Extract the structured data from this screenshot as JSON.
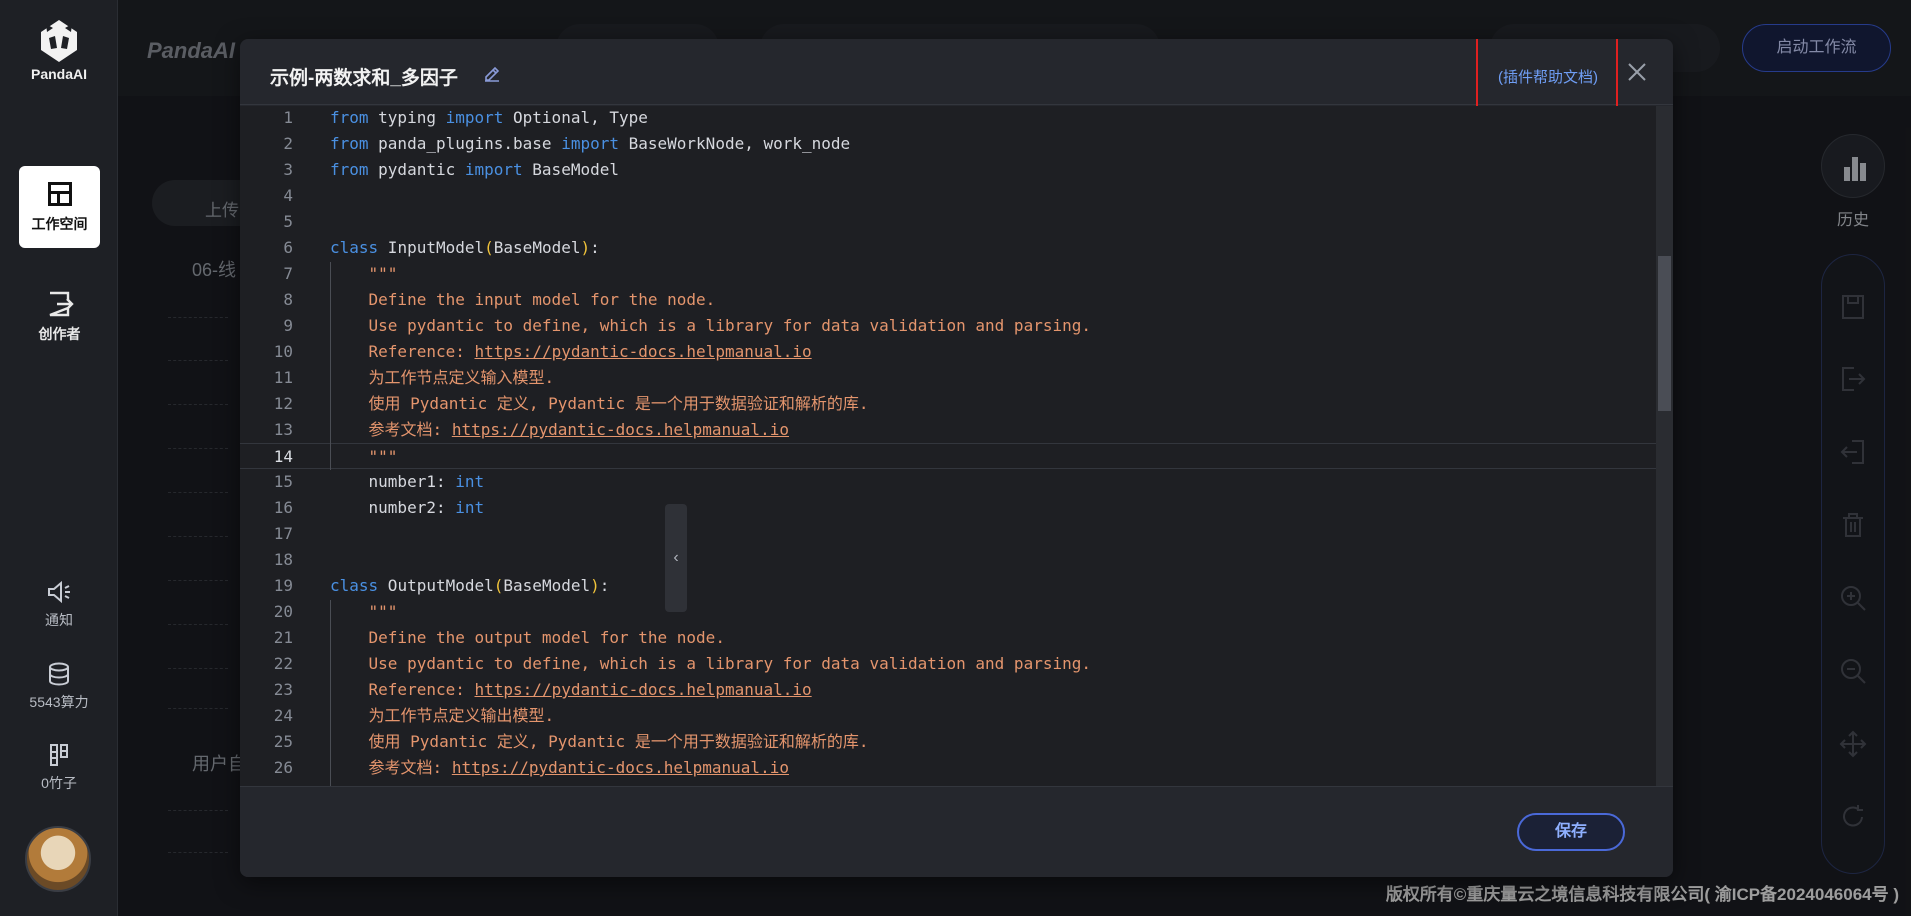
{
  "app": {
    "logo_text": "PandaAI",
    "brand_background": "PandaAI"
  },
  "sidebar": {
    "items": [
      {
        "label": "工作空间",
        "icon": "layout-icon"
      },
      {
        "label": "创作者",
        "icon": "exit-box-icon"
      }
    ],
    "notify": {
      "label": "通知",
      "icon": "speaker-icon"
    },
    "compute": {
      "label": "5543算力",
      "icon": "database-icon"
    },
    "bamboo": {
      "label": "0竹子",
      "icon": "bamboo-icon"
    }
  },
  "topbar": {
    "start_button": "启动工作流"
  },
  "background": {
    "upload_label": "上传",
    "folder1": "06-线",
    "folder2": "用户自"
  },
  "right_rail": {
    "history_label": "历史"
  },
  "modal": {
    "title": "示例-两数求和_多因子",
    "help_link": "(插件帮助文档)",
    "save_button": "保存",
    "collapse_glyph": "‹",
    "lines": [
      {
        "n": "1",
        "parts": [
          {
            "t": "from",
            "c": "kw"
          },
          {
            "t": " typing ",
            "c": "cls"
          },
          {
            "t": "import",
            "c": "kw"
          },
          {
            "t": " Optional, Type",
            "c": "cls"
          }
        ]
      },
      {
        "n": "2",
        "parts": [
          {
            "t": "from",
            "c": "kw"
          },
          {
            "t": " panda_plugins.base ",
            "c": "cls"
          },
          {
            "t": "import",
            "c": "kw"
          },
          {
            "t": " BaseWorkNode, work_node",
            "c": "cls"
          }
        ]
      },
      {
        "n": "3",
        "parts": [
          {
            "t": "from",
            "c": "kw"
          },
          {
            "t": " pydantic ",
            "c": "cls"
          },
          {
            "t": "import",
            "c": "kw"
          },
          {
            "t": " BaseModel",
            "c": "cls"
          }
        ]
      },
      {
        "n": "4",
        "parts": []
      },
      {
        "n": "5",
        "parts": []
      },
      {
        "n": "6",
        "parts": [
          {
            "t": "class",
            "c": "kw"
          },
          {
            "t": " InputModel",
            "c": "cls"
          },
          {
            "t": "(",
            "c": "paren"
          },
          {
            "t": "BaseModel",
            "c": "cls"
          },
          {
            "t": ")",
            "c": "paren"
          },
          {
            "t": ":",
            "c": "cls"
          }
        ]
      },
      {
        "n": "7",
        "parts": [
          {
            "t": "    \"\"\"",
            "c": "doc"
          }
        ]
      },
      {
        "n": "8",
        "parts": [
          {
            "t": "    Define the input model for the node.",
            "c": "doc"
          }
        ]
      },
      {
        "n": "9",
        "parts": [
          {
            "t": "    Use pydantic to define, which is a library for data validation and parsing.",
            "c": "doc"
          }
        ]
      },
      {
        "n": "10",
        "parts": [
          {
            "t": "    Reference: ",
            "c": "doc"
          },
          {
            "t": "https://pydantic-docs.helpmanual.io",
            "c": "link"
          }
        ]
      },
      {
        "n": "11",
        "parts": [
          {
            "t": "    为工作节点定义输入模型.",
            "c": "doc"
          }
        ]
      },
      {
        "n": "12",
        "parts": [
          {
            "t": "    使用 Pydantic 定义, Pydantic 是一个用于数据验证和解析的库.",
            "c": "doc"
          }
        ]
      },
      {
        "n": "13",
        "parts": [
          {
            "t": "    参考文档: ",
            "c": "doc"
          },
          {
            "t": "https://pydantic-docs.helpmanual.io",
            "c": "link"
          }
        ]
      },
      {
        "n": "14",
        "parts": [
          {
            "t": "    \"\"\"",
            "c": "doc"
          }
        ],
        "current": true
      },
      {
        "n": "15",
        "parts": [
          {
            "t": "    number1: ",
            "c": "cls"
          },
          {
            "t": "int",
            "c": "kw"
          }
        ]
      },
      {
        "n": "16",
        "parts": [
          {
            "t": "    number2: ",
            "c": "cls"
          },
          {
            "t": "int",
            "c": "kw"
          }
        ]
      },
      {
        "n": "17",
        "parts": []
      },
      {
        "n": "18",
        "parts": []
      },
      {
        "n": "19",
        "parts": [
          {
            "t": "class",
            "c": "kw"
          },
          {
            "t": " OutputModel",
            "c": "cls"
          },
          {
            "t": "(",
            "c": "paren"
          },
          {
            "t": "BaseModel",
            "c": "cls"
          },
          {
            "t": ")",
            "c": "paren"
          },
          {
            "t": ":",
            "c": "cls"
          }
        ]
      },
      {
        "n": "20",
        "parts": [
          {
            "t": "    \"\"\"",
            "c": "doc"
          }
        ]
      },
      {
        "n": "21",
        "parts": [
          {
            "t": "    Define the output model for the node.",
            "c": "doc"
          }
        ]
      },
      {
        "n": "22",
        "parts": [
          {
            "t": "    Use pydantic to define, which is a library for data validation and parsing.",
            "c": "doc"
          }
        ]
      },
      {
        "n": "23",
        "parts": [
          {
            "t": "    Reference: ",
            "c": "doc"
          },
          {
            "t": "https://pydantic-docs.helpmanual.io",
            "c": "link"
          }
        ]
      },
      {
        "n": "24",
        "parts": [
          {
            "t": "    为工作节点定义输出模型.",
            "c": "doc"
          }
        ]
      },
      {
        "n": "25",
        "parts": [
          {
            "t": "    使用 Pydantic 定义, Pydantic 是一个用于数据验证和解析的库.",
            "c": "doc"
          }
        ]
      },
      {
        "n": "26",
        "parts": [
          {
            "t": "    参考文档: ",
            "c": "doc"
          },
          {
            "t": "https://pydantic-docs.helpmanual.io",
            "c": "link"
          }
        ]
      }
    ]
  },
  "footer": {
    "copyright": "版权所有©重庆量云之境信息科技有限公司( 渝ICP备2024046064号 )"
  },
  "colors": {
    "keyword": "#4a90e2",
    "docstring": "#e4956d",
    "accent": "#4a69d8",
    "highlight": "#e02020"
  }
}
